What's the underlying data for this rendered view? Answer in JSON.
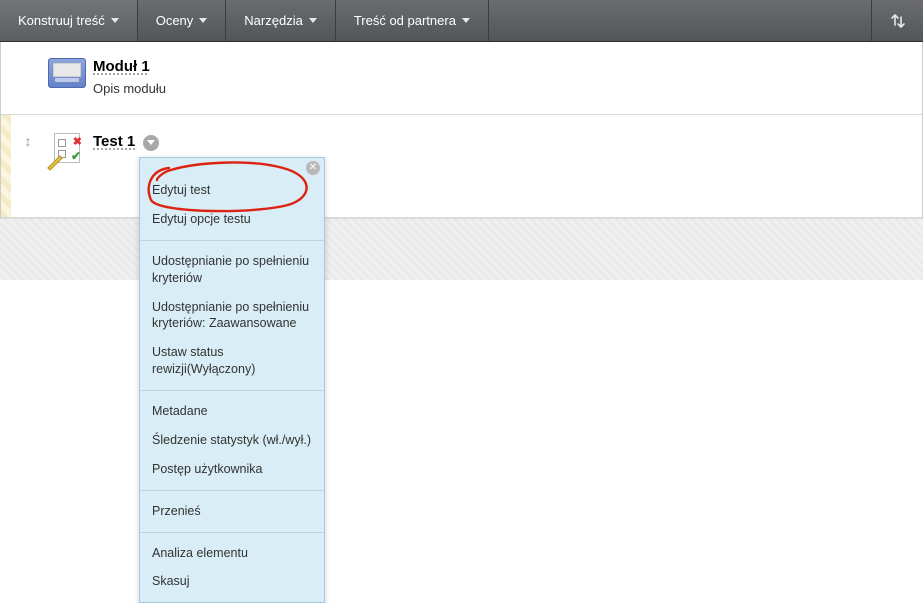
{
  "nav": {
    "items": [
      {
        "label": "Konstruuj treść"
      },
      {
        "label": "Oceny"
      },
      {
        "label": "Narzędzia"
      },
      {
        "label": "Treść od partnera"
      }
    ]
  },
  "module": {
    "title": "Moduł 1",
    "description": "Opis modułu"
  },
  "test_item": {
    "title": "Test 1"
  },
  "context_menu": {
    "groups": [
      {
        "items": [
          {
            "label": "Edytuj test"
          },
          {
            "label": "Edytuj opcje testu"
          }
        ]
      },
      {
        "items": [
          {
            "label": "Udostępnianie po spełnieniu kryteriów"
          },
          {
            "label": "Udostępnianie po spełnieniu kryteriów: Zaawansowane"
          },
          {
            "label": "Ustaw status rewizji(Wyłączony)"
          }
        ]
      },
      {
        "items": [
          {
            "label": "Metadane"
          },
          {
            "label": "Śledzenie statystyk (wł./wył.)"
          },
          {
            "label": "Postęp użytkownika"
          }
        ]
      },
      {
        "items": [
          {
            "label": "Przenieś"
          }
        ]
      },
      {
        "items": [
          {
            "label": "Analiza elementu"
          },
          {
            "label": "Skasuj"
          }
        ]
      }
    ]
  }
}
